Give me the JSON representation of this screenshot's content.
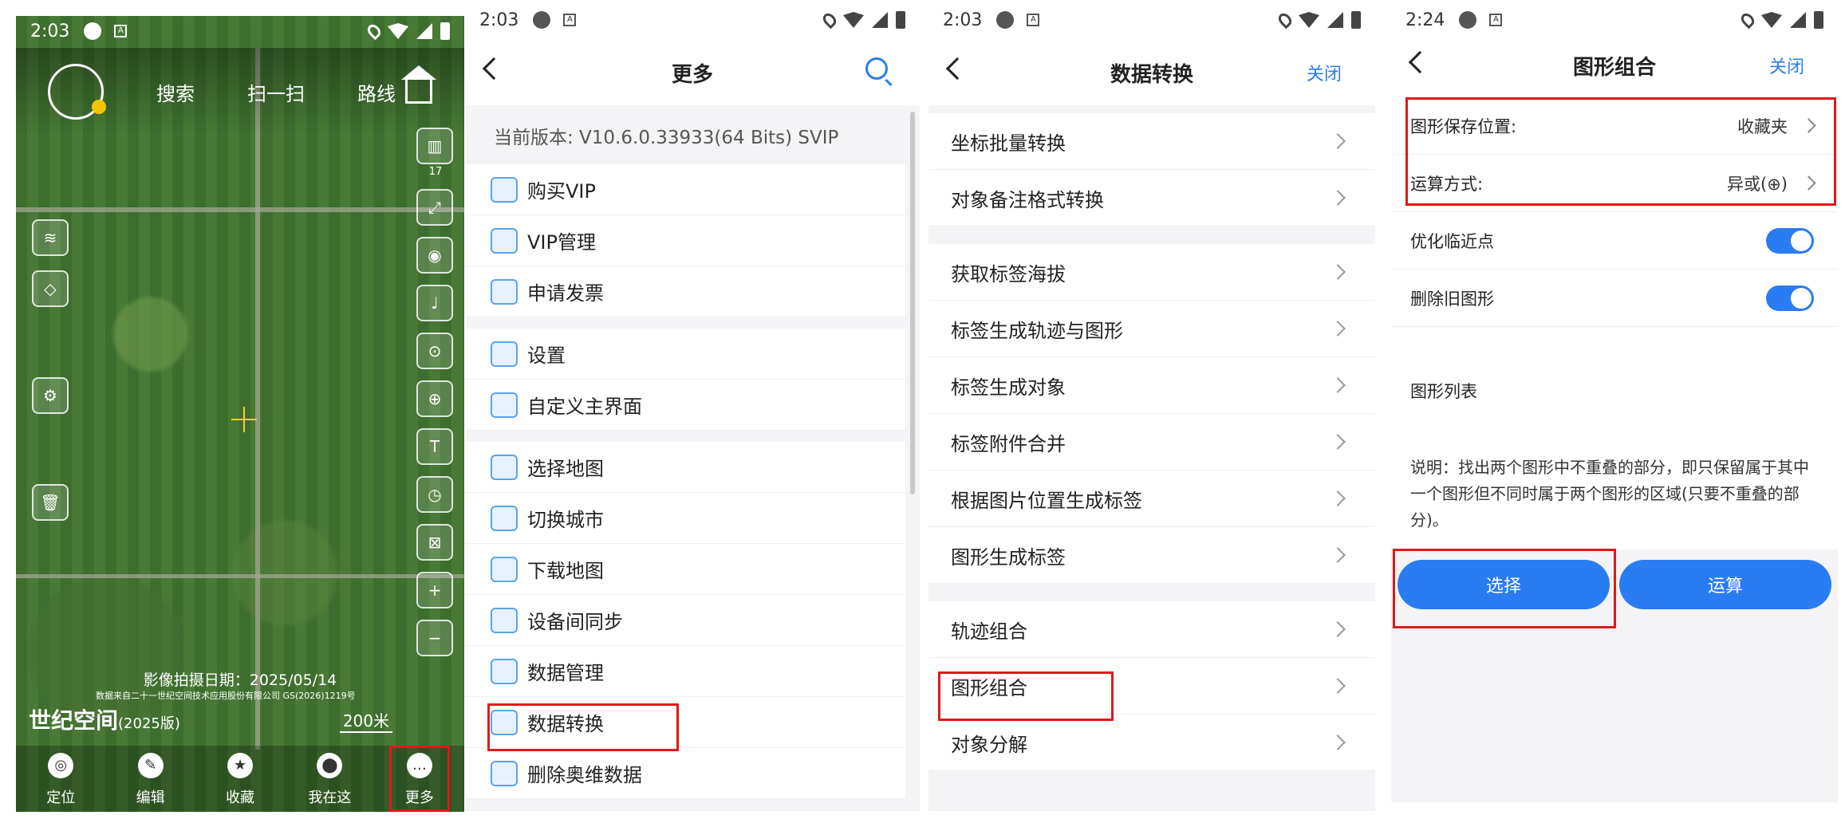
{
  "screen1": {
    "time": "2:03",
    "top_tabs": [
      "搜索",
      "扫一扫",
      "路线"
    ],
    "zoom_level": "17",
    "photo_date": "影像拍摄日期：2025/05/14",
    "copyright": "数据来自二十一世纪空间技术应用股份有限公司 GS(2026)1219号",
    "brand": "世纪空间",
    "brand_year": "(2025版)",
    "scale": "200米",
    "bottom_nav": [
      "定位",
      "编辑",
      "收藏",
      "我在这",
      "更多"
    ]
  },
  "screen2": {
    "time": "2:03",
    "title": "更多",
    "version": "当前版本: V10.6.0.33933(64 Bits) SVIP",
    "groups": [
      [
        "购买VIP",
        "VIP管理",
        "申请发票"
      ],
      [
        "设置",
        "自定义主界面"
      ],
      [
        "选择地图",
        "切换城市",
        "下载地图",
        "设备间同步",
        "数据管理",
        "数据转换",
        "删除奥维数据"
      ]
    ]
  },
  "screen3": {
    "time": "2:03",
    "title": "数据转换",
    "close": "关闭",
    "groups": [
      [
        "坐标批量转换",
        "对象备注格式转换"
      ],
      [
        "获取标签海拔",
        "标签生成轨迹与图形",
        "标签生成对象",
        "标签附件合并",
        "根据图片位置生成标签",
        "图形生成标签"
      ],
      [
        "轨迹组合",
        "图形组合",
        "对象分解"
      ]
    ]
  },
  "screen4": {
    "time": "2:24",
    "title": "图形组合",
    "close": "关闭",
    "save_location_label": "图形保存位置:",
    "save_location_value": "收藏夹",
    "operation_label": "运算方式:",
    "operation_value": "异或(⊕)",
    "optimize_label": "优化临近点",
    "delete_label": "删除旧图形",
    "list_label": "图形列表",
    "description": "说明：找出两个图形中不重叠的部分，即只保留属于其中一个图形但不同时属于两个图形的区域(只要不重叠的部分)。",
    "select_button": "选择",
    "compute_button": "运算"
  },
  "colors": {
    "accent": "#2a7cf2",
    "highlight": "#e01818"
  }
}
